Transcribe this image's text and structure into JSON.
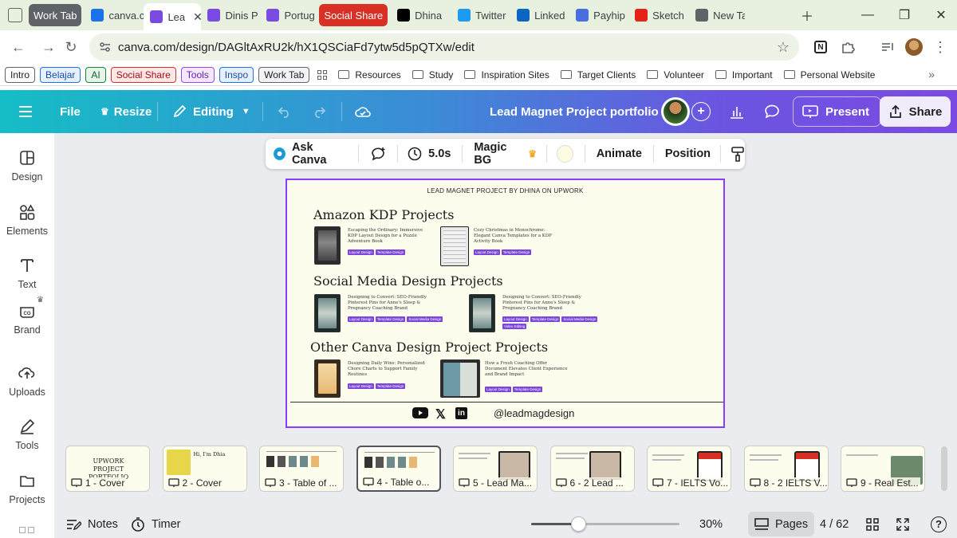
{
  "browser": {
    "tabs": [
      {
        "label": "Work Tab",
        "type": "group",
        "color": "#5f6368"
      },
      {
        "label": "canva.c",
        "type": "tab",
        "color": "#1a73e8"
      },
      {
        "label": "Lea",
        "type": "active",
        "color": "#7b4ae2"
      },
      {
        "label": "Dinis P",
        "type": "tab",
        "color": "#7b4ae2"
      },
      {
        "label": "Portug",
        "type": "tab",
        "color": "#7b4ae2"
      },
      {
        "label": "Social Share",
        "type": "group",
        "color": "#d93025"
      },
      {
        "label": "Dhina",
        "type": "tab",
        "color": "#000000"
      },
      {
        "label": "Twitter",
        "type": "tab",
        "color": "#1d9bf0"
      },
      {
        "label": "Linked",
        "type": "tab",
        "color": "#0a66c2"
      },
      {
        "label": "Payhip",
        "type": "tab",
        "color": "#4a6ee0"
      },
      {
        "label": "Sketch",
        "type": "tab",
        "color": "#e62117"
      },
      {
        "label": "New Ta",
        "type": "tab",
        "color": "#5f6368"
      }
    ],
    "url": "canva.com/design/DAGltAxRU2k/hX1QSCiaFd7ytw5d5pQTXw/edit",
    "bookmark_chips": [
      {
        "label": "Intro",
        "border": "#5f6368",
        "bg": "#ffffff",
        "color": "#202124"
      },
      {
        "label": "Belajar",
        "border": "#1a73e8",
        "bg": "#e8f0fe",
        "color": "#174ea6"
      },
      {
        "label": "AI",
        "border": "#188038",
        "bg": "#e6f4ea",
        "color": "#0d652d"
      },
      {
        "label": "Social Share",
        "border": "#d93025",
        "bg": "#fce8e6",
        "color": "#a50e0e"
      },
      {
        "label": "Tools",
        "border": "#a142f4",
        "bg": "#f3e8fd",
        "color": "#681da8"
      },
      {
        "label": "Inspo",
        "border": "#1a73e8",
        "bg": "#e8f0fe",
        "color": "#174ea6"
      },
      {
        "label": "Work Tab",
        "border": "#5f6368",
        "bg": "#f1f3f4",
        "color": "#202124"
      }
    ],
    "bookmark_folders": [
      "Resources",
      "Study",
      "Inspiration Sites",
      "Target Clients",
      "Volunteer",
      "Important",
      "Personal Website"
    ]
  },
  "canva": {
    "header": {
      "file": "File",
      "resize": "Resize",
      "editing": "Editing",
      "title": "Lead Magnet Project portfolio",
      "present": "Present",
      "share": "Share"
    },
    "sidebar": [
      {
        "label": "Design",
        "icon": "design-icon"
      },
      {
        "label": "Elements",
        "icon": "elements-icon"
      },
      {
        "label": "Text",
        "icon": "text-icon"
      },
      {
        "label": "Brand",
        "icon": "brand-icon"
      },
      {
        "label": "Uploads",
        "icon": "uploads-icon"
      },
      {
        "label": "Tools",
        "icon": "tools-icon"
      },
      {
        "label": "Projects",
        "icon": "projects-icon"
      }
    ],
    "context_toolbar": {
      "ask": "Ask Canva",
      "duration": "5.0s",
      "magic_bg": "Magic BG",
      "animate": "Animate",
      "position": "Position",
      "bg_swatch": "#fdfbe2"
    },
    "page": {
      "title": "LEAD MAGNET PROJECT BY DHINA ON UPWORK",
      "sections": [
        {
          "heading": "Amazon KDP Projects",
          "items": [
            {
              "text": "Escaping the Ordinary: Immersive KDP Layout Design for a Puzzle Adventure Book",
              "tags": [
                "Layout Design",
                "Template Design"
              ]
            },
            {
              "text": "Cozy Christmas in Monochrome: Elegant Canva Templates for a KDP Activity Book",
              "tags": [
                "Layout Design",
                "Template Design"
              ]
            }
          ]
        },
        {
          "heading": "Social Media Design Projects",
          "items": [
            {
              "text": "Designing to Convert: SEO-Friendly Pinterest Pins for Anne's Sleep & Pregnancy Coaching Brand",
              "tags": [
                "Layout Design",
                "Template Design",
                "Social Media Design"
              ]
            },
            {
              "text": "Designing to Convert: SEO-Friendly Pinterest Pins for Anne's Sleep & Pregnancy Coaching Brand",
              "tags": [
                "Layout Design",
                "Template Design",
                "Social Media Design",
                "Video Editing"
              ]
            }
          ]
        },
        {
          "heading": "Other Canva Design Project Projects",
          "items": [
            {
              "text": "Designing Daily Wins: Personalized Chore Charts to Support Family Routines",
              "tags": [
                "Layout Design",
                "Template Design"
              ]
            },
            {
              "text": "How a Fresh Coaching Offer Document Elevates Client Experience and Brand Impact",
              "tags": [
                "Layout Design",
                "Template Design"
              ]
            }
          ]
        }
      ],
      "handle": "@leadmagdesign"
    },
    "filmstrip": [
      {
        "label": "1 - Cover",
        "preview": "UPWORK PROJECT PORTFOLIO"
      },
      {
        "label": "2 - Cover",
        "preview": "Hi, I'm Dhia"
      },
      {
        "label": "3 - Table of ...",
        "preview": ""
      },
      {
        "label": "4 - Table o...",
        "preview": ""
      },
      {
        "label": "5 - Lead Ma...",
        "preview": ""
      },
      {
        "label": "6 - 2 Lead ...",
        "preview": ""
      },
      {
        "label": "7 - IELTS Vo...",
        "preview": ""
      },
      {
        "label": "8 - 2 IELTS V...",
        "preview": ""
      },
      {
        "label": "9 - Real Est...",
        "preview": ""
      }
    ],
    "selected_slide": 3,
    "bottom": {
      "notes": "Notes",
      "timer": "Timer",
      "zoom": "30%",
      "zoom_level": 0.3,
      "pages": "Pages",
      "page_count": "4 / 62"
    },
    "colors": {
      "accent": "#8b3dff",
      "tag": "#7a45d8"
    }
  }
}
